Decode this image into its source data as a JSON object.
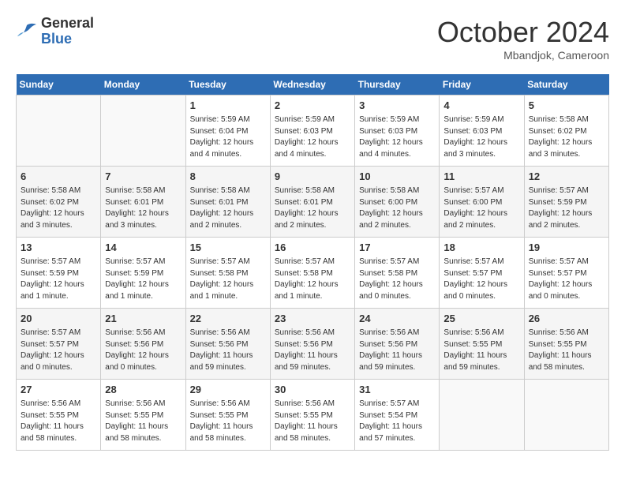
{
  "logo": {
    "general": "General",
    "blue": "Blue"
  },
  "title": {
    "month_year": "October 2024",
    "location": "Mbandjok, Cameroon"
  },
  "days_of_week": [
    "Sunday",
    "Monday",
    "Tuesday",
    "Wednesday",
    "Thursday",
    "Friday",
    "Saturday"
  ],
  "weeks": [
    [
      {
        "day": "",
        "info": ""
      },
      {
        "day": "",
        "info": ""
      },
      {
        "day": "1",
        "info": "Sunrise: 5:59 AM\nSunset: 6:04 PM\nDaylight: 12 hours\nand 4 minutes."
      },
      {
        "day": "2",
        "info": "Sunrise: 5:59 AM\nSunset: 6:03 PM\nDaylight: 12 hours\nand 4 minutes."
      },
      {
        "day": "3",
        "info": "Sunrise: 5:59 AM\nSunset: 6:03 PM\nDaylight: 12 hours\nand 4 minutes."
      },
      {
        "day": "4",
        "info": "Sunrise: 5:59 AM\nSunset: 6:03 PM\nDaylight: 12 hours\nand 3 minutes."
      },
      {
        "day": "5",
        "info": "Sunrise: 5:58 AM\nSunset: 6:02 PM\nDaylight: 12 hours\nand 3 minutes."
      }
    ],
    [
      {
        "day": "6",
        "info": "Sunrise: 5:58 AM\nSunset: 6:02 PM\nDaylight: 12 hours\nand 3 minutes."
      },
      {
        "day": "7",
        "info": "Sunrise: 5:58 AM\nSunset: 6:01 PM\nDaylight: 12 hours\nand 3 minutes."
      },
      {
        "day": "8",
        "info": "Sunrise: 5:58 AM\nSunset: 6:01 PM\nDaylight: 12 hours\nand 2 minutes."
      },
      {
        "day": "9",
        "info": "Sunrise: 5:58 AM\nSunset: 6:01 PM\nDaylight: 12 hours\nand 2 minutes."
      },
      {
        "day": "10",
        "info": "Sunrise: 5:58 AM\nSunset: 6:00 PM\nDaylight: 12 hours\nand 2 minutes."
      },
      {
        "day": "11",
        "info": "Sunrise: 5:57 AM\nSunset: 6:00 PM\nDaylight: 12 hours\nand 2 minutes."
      },
      {
        "day": "12",
        "info": "Sunrise: 5:57 AM\nSunset: 5:59 PM\nDaylight: 12 hours\nand 2 minutes."
      }
    ],
    [
      {
        "day": "13",
        "info": "Sunrise: 5:57 AM\nSunset: 5:59 PM\nDaylight: 12 hours\nand 1 minute."
      },
      {
        "day": "14",
        "info": "Sunrise: 5:57 AM\nSunset: 5:59 PM\nDaylight: 12 hours\nand 1 minute."
      },
      {
        "day": "15",
        "info": "Sunrise: 5:57 AM\nSunset: 5:58 PM\nDaylight: 12 hours\nand 1 minute."
      },
      {
        "day": "16",
        "info": "Sunrise: 5:57 AM\nSunset: 5:58 PM\nDaylight: 12 hours\nand 1 minute."
      },
      {
        "day": "17",
        "info": "Sunrise: 5:57 AM\nSunset: 5:58 PM\nDaylight: 12 hours\nand 0 minutes."
      },
      {
        "day": "18",
        "info": "Sunrise: 5:57 AM\nSunset: 5:57 PM\nDaylight: 12 hours\nand 0 minutes."
      },
      {
        "day": "19",
        "info": "Sunrise: 5:57 AM\nSunset: 5:57 PM\nDaylight: 12 hours\nand 0 minutes."
      }
    ],
    [
      {
        "day": "20",
        "info": "Sunrise: 5:57 AM\nSunset: 5:57 PM\nDaylight: 12 hours\nand 0 minutes."
      },
      {
        "day": "21",
        "info": "Sunrise: 5:56 AM\nSunset: 5:56 PM\nDaylight: 12 hours\nand 0 minutes."
      },
      {
        "day": "22",
        "info": "Sunrise: 5:56 AM\nSunset: 5:56 PM\nDaylight: 11 hours\nand 59 minutes."
      },
      {
        "day": "23",
        "info": "Sunrise: 5:56 AM\nSunset: 5:56 PM\nDaylight: 11 hours\nand 59 minutes."
      },
      {
        "day": "24",
        "info": "Sunrise: 5:56 AM\nSunset: 5:56 PM\nDaylight: 11 hours\nand 59 minutes."
      },
      {
        "day": "25",
        "info": "Sunrise: 5:56 AM\nSunset: 5:55 PM\nDaylight: 11 hours\nand 59 minutes."
      },
      {
        "day": "26",
        "info": "Sunrise: 5:56 AM\nSunset: 5:55 PM\nDaylight: 11 hours\nand 58 minutes."
      }
    ],
    [
      {
        "day": "27",
        "info": "Sunrise: 5:56 AM\nSunset: 5:55 PM\nDaylight: 11 hours\nand 58 minutes."
      },
      {
        "day": "28",
        "info": "Sunrise: 5:56 AM\nSunset: 5:55 PM\nDaylight: 11 hours\nand 58 minutes."
      },
      {
        "day": "29",
        "info": "Sunrise: 5:56 AM\nSunset: 5:55 PM\nDaylight: 11 hours\nand 58 minutes."
      },
      {
        "day": "30",
        "info": "Sunrise: 5:56 AM\nSunset: 5:55 PM\nDaylight: 11 hours\nand 58 minutes."
      },
      {
        "day": "31",
        "info": "Sunrise: 5:57 AM\nSunset: 5:54 PM\nDaylight: 11 hours\nand 57 minutes."
      },
      {
        "day": "",
        "info": ""
      },
      {
        "day": "",
        "info": ""
      }
    ]
  ]
}
